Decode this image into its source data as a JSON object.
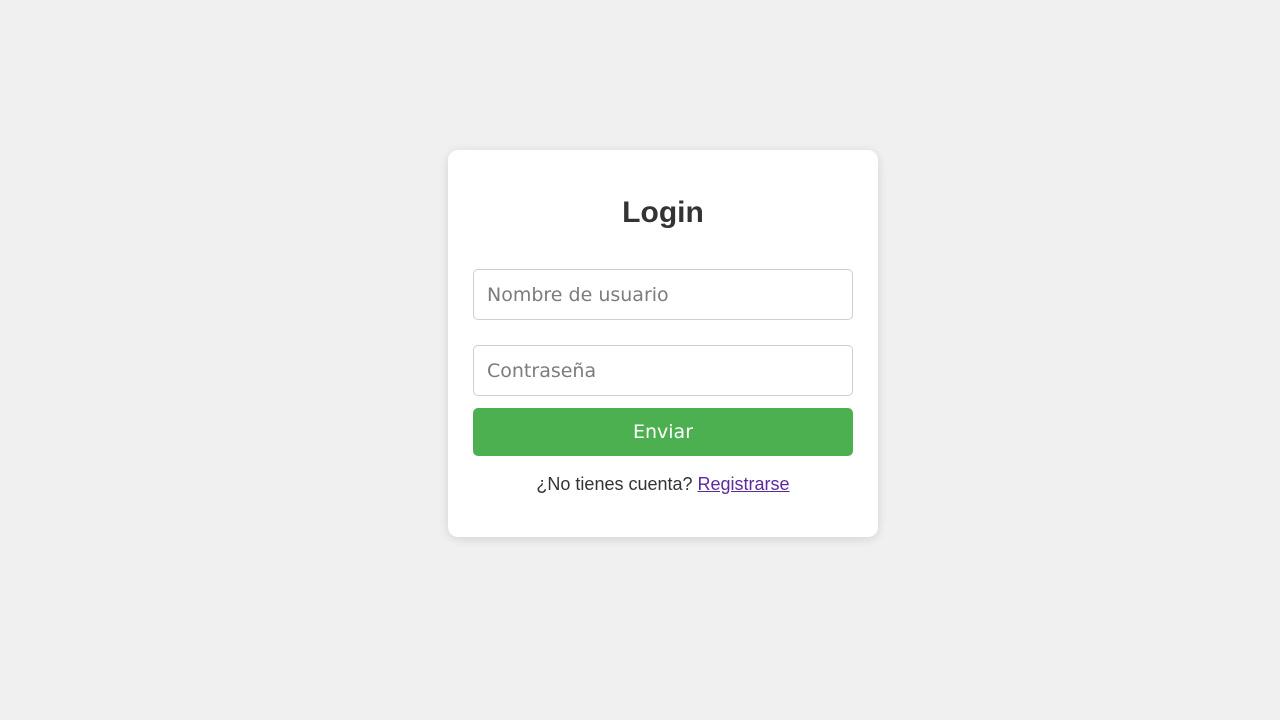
{
  "login": {
    "title": "Login",
    "username_placeholder": "Nombre de usuario",
    "password_placeholder": "Contraseña",
    "submit_label": "Enviar",
    "no_account_text": "¿No tienes cuenta?",
    "register_link_label": "Registrarse"
  },
  "colors": {
    "background": "#f0f0f0",
    "card": "#ffffff",
    "submit_button": "#4caf50",
    "link": "#5b2a9c"
  }
}
